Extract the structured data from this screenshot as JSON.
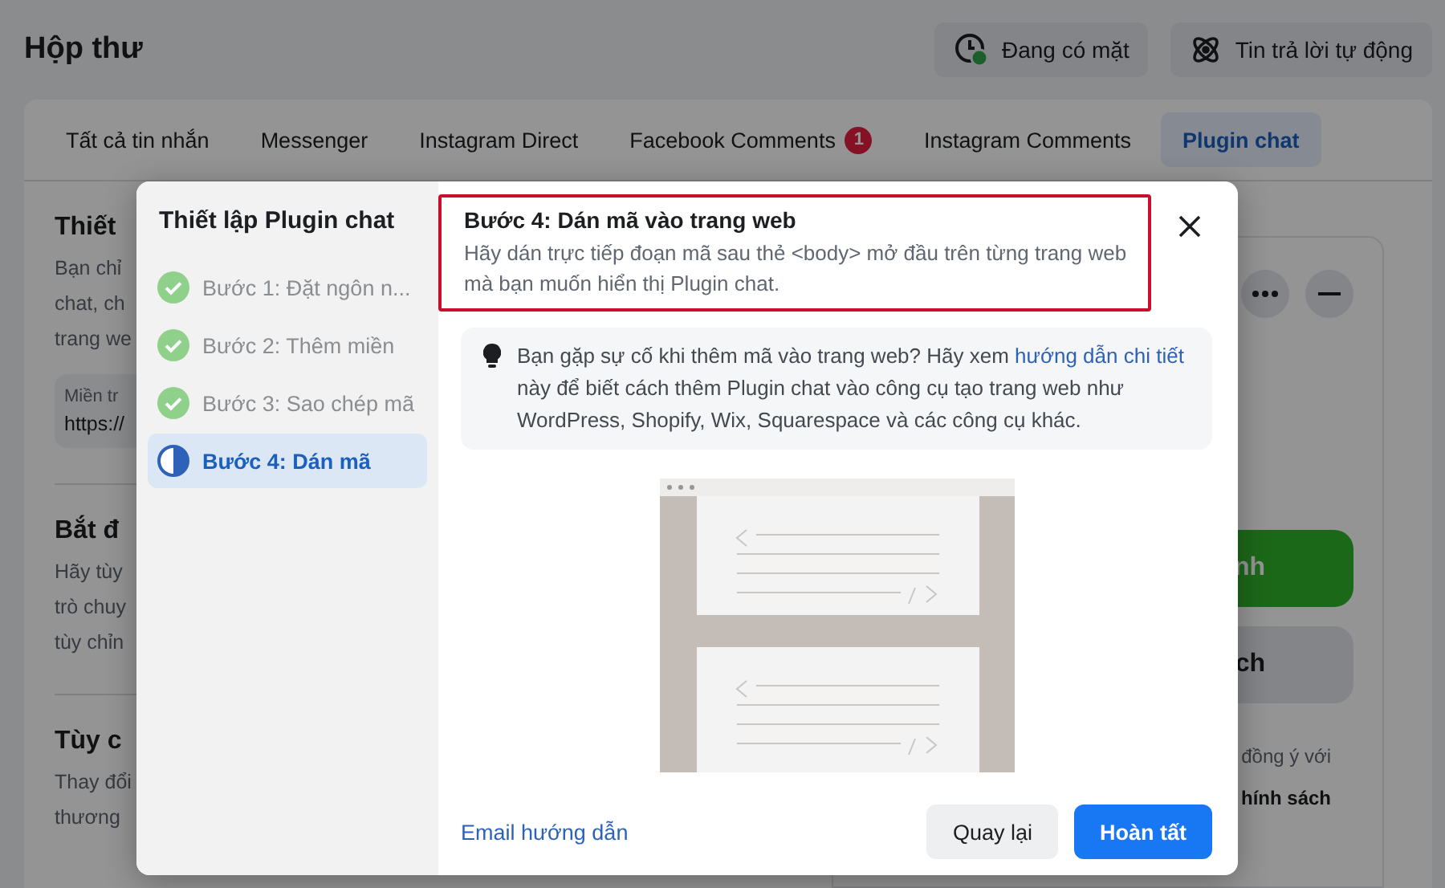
{
  "header": {
    "title": "Hộp thư",
    "buttons": [
      {
        "label": "Đang có mặt",
        "kind": "presence",
        "online": true
      },
      {
        "label": "Tin trả lời tự động",
        "kind": "auto"
      }
    ]
  },
  "tabs": [
    {
      "label": "Tất cả tin nhắn",
      "selected": false
    },
    {
      "label": "Messenger",
      "selected": false
    },
    {
      "label": "Instagram Direct",
      "selected": false
    },
    {
      "label": "Facebook Comments",
      "badge": "1",
      "selected": false
    },
    {
      "label": "Instagram Comments",
      "selected": false
    },
    {
      "label": "Plugin chat",
      "selected": true
    }
  ],
  "sections": [
    {
      "title": "Thiết",
      "lines": [
        "Bạn chỉ",
        "chat, ch",
        "trang we"
      ],
      "field": {
        "label": "Miền tr",
        "value": "https://"
      }
    },
    {
      "title": "Bắt đ",
      "lines": [
        "Hãy tùy",
        "trò chuy",
        "tùy chỉn"
      ]
    },
    {
      "title": "Tùy c",
      "lines": [
        "Thay đổi",
        "thương"
      ]
    }
  ],
  "preview": {
    "primary_button": "nh",
    "secondary_button": "ch",
    "consent": "đồng ý với",
    "policy": "hính sách"
  },
  "modal": {
    "title": "Thiết lập Plugin chat",
    "steps": [
      {
        "label": "Bước 1: Đặt ngôn n...",
        "completed": true,
        "selected": false
      },
      {
        "label": "Bước 2: Thêm miền",
        "completed": true,
        "selected": false
      },
      {
        "label": "Bước 3: Sao chép mã",
        "completed": true,
        "selected": false
      },
      {
        "label": "Bước 4: Dán mã",
        "completed": false,
        "selected": true
      }
    ],
    "heading": "Bước 4: Dán mã vào trang web",
    "highlighted": true,
    "description": "Hãy dán trực tiếp đoạn mã sau thẻ <body> mở đầu trên từng trang web mà bạn muốn hiển thị Plugin chat.",
    "tip": {
      "before": "Bạn gặp sự cố khi thêm mã vào trang web? Hãy xem ",
      "link": "hướng dẫn chi tiết",
      "after": " này để biết cách thêm Plugin chat vào công cụ tạo trang web như WordPress, Shopify, Wix, Squarespace và các công cụ khác."
    },
    "email_link": "Email hướng dẫn",
    "back_button": "Quay lại",
    "finish_button": "Hoàn tất"
  }
}
